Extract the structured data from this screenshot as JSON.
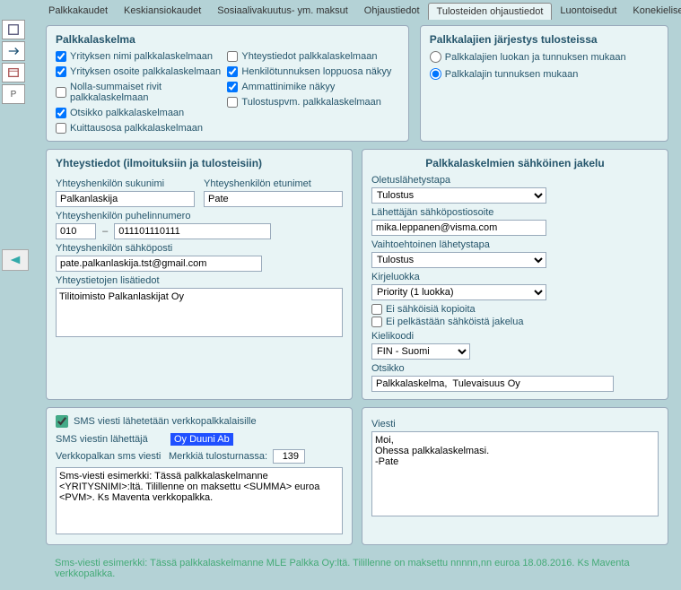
{
  "tabs": [
    "Palkkakaudet",
    "Keskiansiokaudet",
    "Sosiaalivakuutus- ym. maksut",
    "Ohjaustiedot",
    "Tulosteiden ohjaustiedot",
    "Luontoisedut",
    "Konekieliset aineistot"
  ],
  "sidebar_p": "P",
  "payslip": {
    "title": "Palkkalaskelma",
    "chk1": "Yrityksen nimi palkkalaskelmaan",
    "chk2": "Yrityksen osoite palkkalaskelmaan",
    "chk3": "Nolla-summaiset rivit palkkalaskelmaan",
    "chk4": "Otsikko palkkalaskelmaan",
    "chk5": "Kuittausosa palkkalaskelmaan",
    "chk6": "Yhteystiedot palkkalaskelmaan",
    "chk7": "Henkilötunnuksen loppuosa näkyy",
    "chk8": "Ammattinimike näkyy",
    "chk9": "Tulostuspvm. palkkalaskelmaan"
  },
  "order": {
    "title": "Palkkalajien järjestys tulosteissa",
    "opt1": "Palkkalajien luokan ja tunnuksen mukaan",
    "opt2": "Palkkalajin tunnuksen mukaan"
  },
  "contact": {
    "title": "Yhteystiedot (ilmoituksiin ja tulosteisiin)",
    "surname_lbl": "Yhteyshenkilön sukunimi",
    "surname": "Palkanlaskija",
    "first_lbl": "Yhteyshenkilön etunimet",
    "first": "Pate",
    "phone_lbl": "Yhteyshenkilön puhelinnumero",
    "phone_pre": "010",
    "phone_num": "011101110111",
    "email_lbl": "Yhteyshenkilön sähköposti",
    "email": "pate.palkanlaskija.tst@gmail.com",
    "extra_lbl": "Yhteystietojen lisätiedot",
    "extra": "Tilitoimisto Palkanlaskijat Oy"
  },
  "dist": {
    "title": "Palkkalaskelmien sähköinen jakelu",
    "def_lbl": "Oletuslähetystapa",
    "def_val": "Tulostus",
    "sender_lbl": "Lähettäjän sähköpostiosoite",
    "sender": "mika.leppanen@visma.com",
    "alt_lbl": "Vaihtoehtoinen lähetystapa",
    "alt_val": "Tulostus",
    "letter_lbl": "Kirjeluokka",
    "letter_val": "Priority (1 luokka)",
    "nocopy": "Ei sähköisiä kopioita",
    "onlye": "Ei pelkästään sähköistä jakelua",
    "lang_lbl": "Kielikoodi",
    "lang_val": "FIN - Suomi",
    "title_lbl": "Otsikko",
    "title_val": "Palkkalaskelma,  Tulevaisuus Oy"
  },
  "sms": {
    "chk": "SMS viesti lähetetään verkkopalkkalaisille",
    "sender_lbl": "SMS viestin lähettäjä",
    "sender": "Oy Duuni Ab",
    "msg_lbl": "Verkkopalkan sms viesti",
    "mark_lbl": "Merkkiä tulosturnassa:",
    "mark_val": "139",
    "msg": "Sms-viesti esimerkki: Tässä palkkalaskelmanne <YRITYSNIMI>:ltä. Tilillenne on maksettu <SUMMA> euroa <PVM>. Ks Maventa verkkopalkka."
  },
  "msg": {
    "lbl": "Viesti",
    "val": "Moi,\nOhessa palkkalaskelmasi.\n-Pate"
  },
  "footer": "Sms-viesti esimerkki: Tässä palkkalaskelmanne MLE Palkka Oy:ltä. Tilillenne on maksettu nnnnn,nn euroa 18.08.2016. Ks Maventa verkkopalkka."
}
